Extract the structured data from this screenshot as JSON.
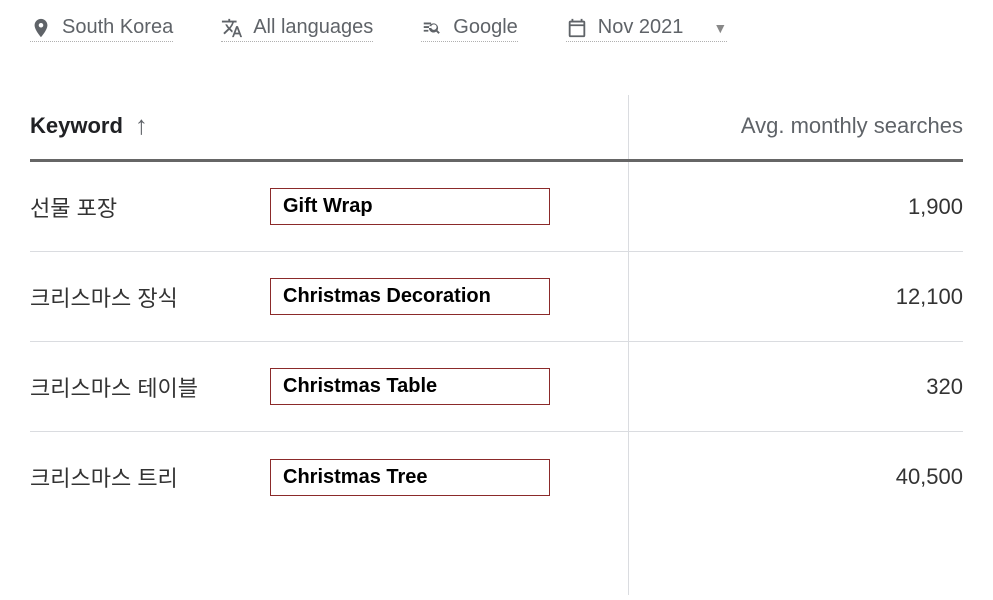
{
  "toolbar": {
    "location": "South Korea",
    "language": "All languages",
    "engine": "Google",
    "date": "Nov 2021"
  },
  "headers": {
    "keyword": "Keyword",
    "searches": "Avg. monthly searches"
  },
  "rows": [
    {
      "keyword": "선물 포장",
      "translation": "Gift Wrap",
      "searches": "1,900"
    },
    {
      "keyword": "크리스마스 장식",
      "translation": "Christmas Decoration",
      "searches": "12,100"
    },
    {
      "keyword": "크리스마스 테이블",
      "translation": "Christmas Table",
      "searches": "320"
    },
    {
      "keyword": "크리스마스 트리",
      "translation": "Christmas Tree",
      "searches": "40,500"
    }
  ]
}
